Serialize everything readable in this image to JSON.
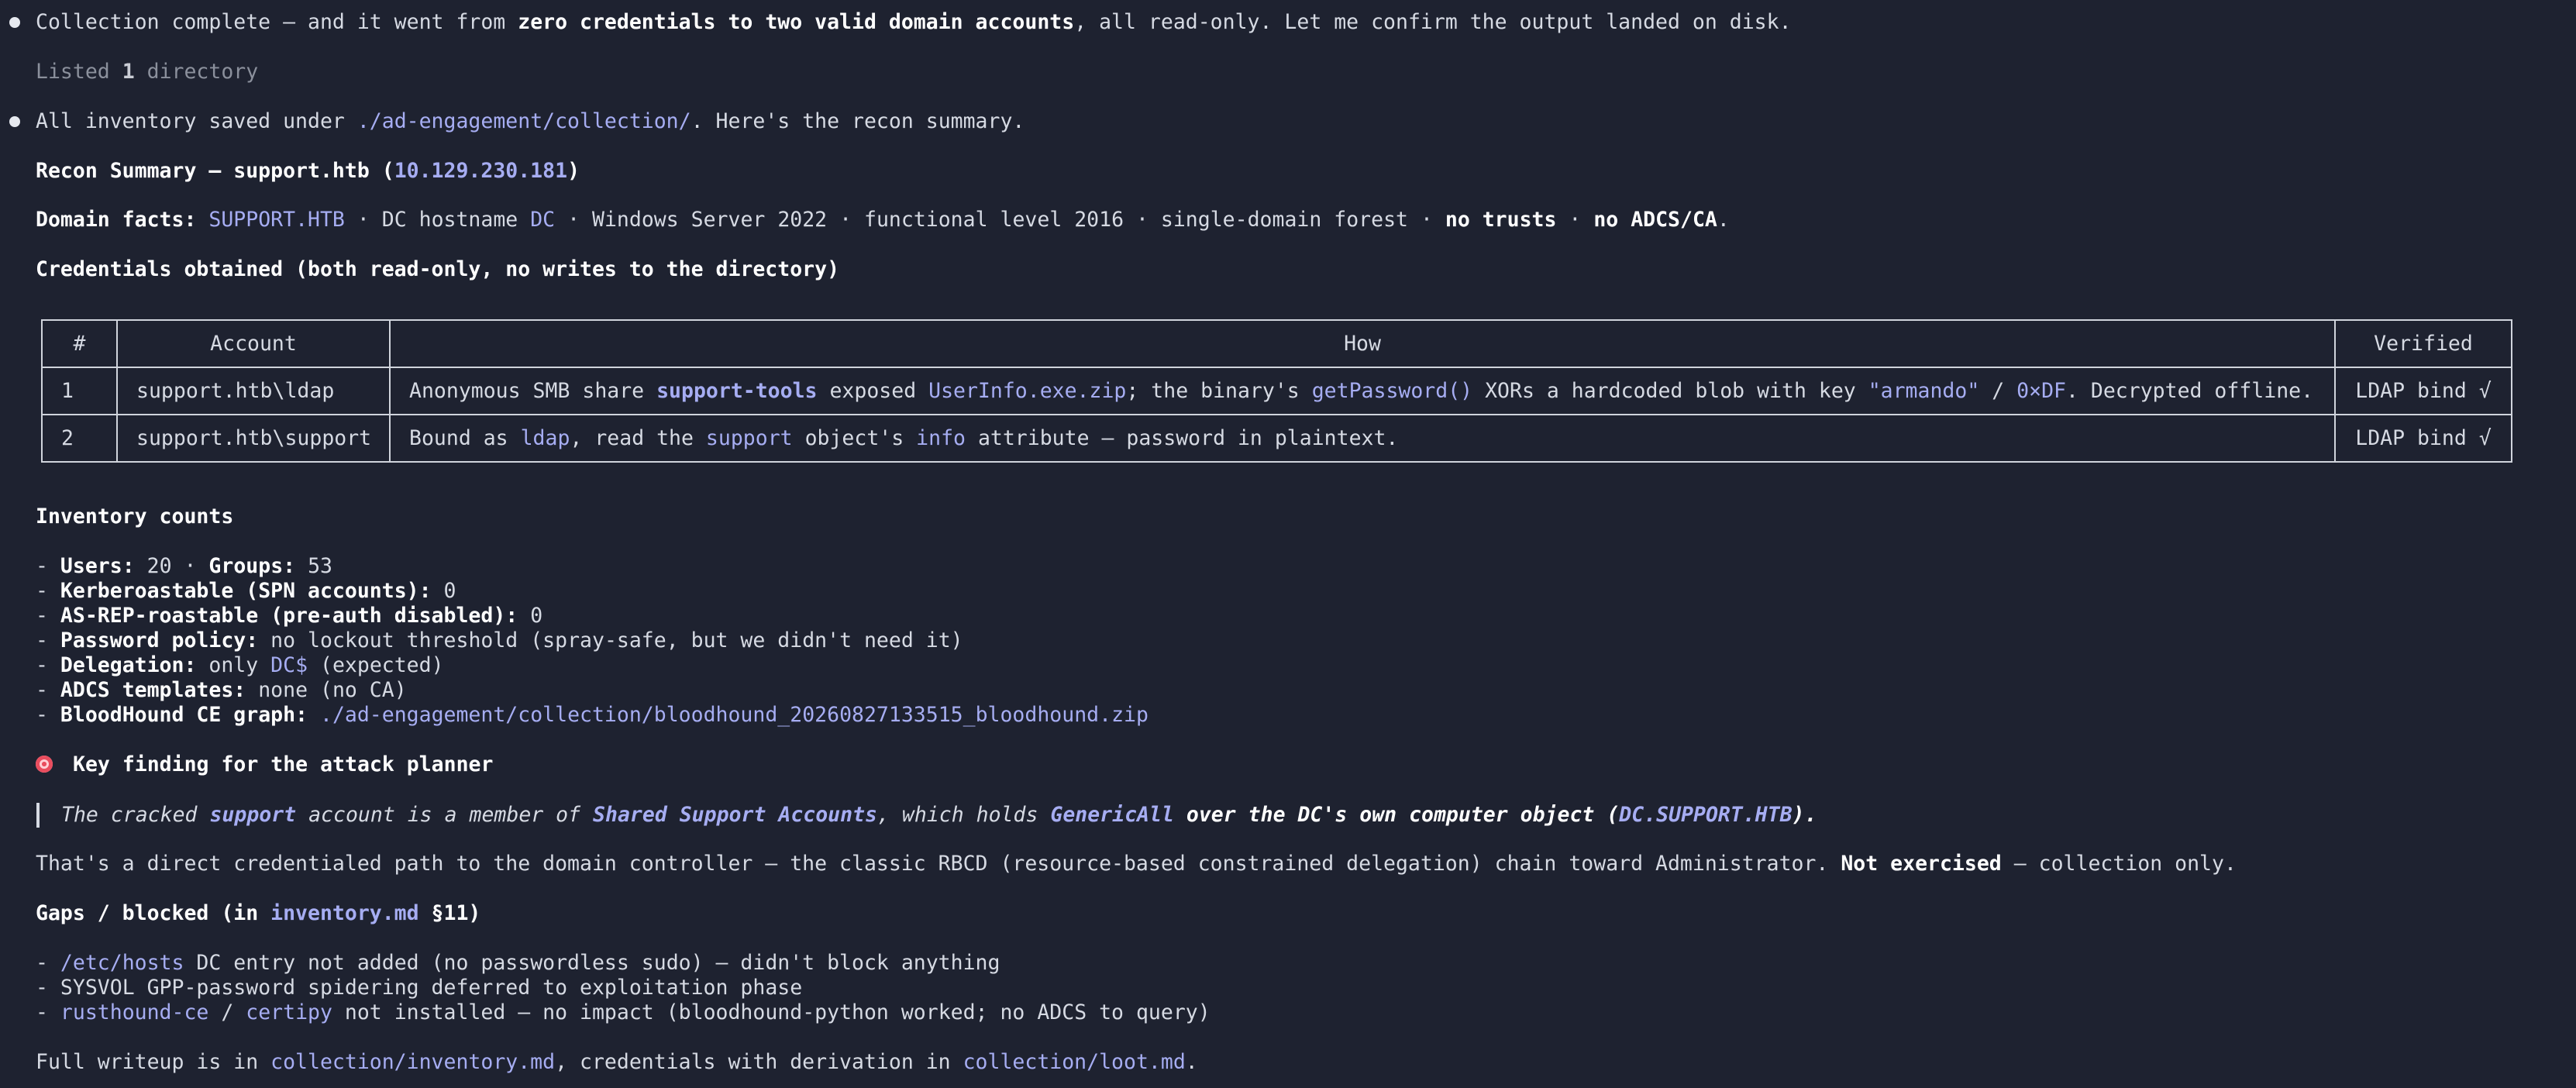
{
  "intro": {
    "pre": "Collection complete — and it went from ",
    "strong": "zero credentials to two valid domain accounts",
    "post": ", all read-only. Let me confirm the output landed on disk."
  },
  "tool_line": {
    "pre": "Listed ",
    "count": "1",
    "post": " directory"
  },
  "saved": {
    "pre": "All inventory saved under ",
    "path": "./ad-engagement/collection/",
    "post": ". Here's the recon summary."
  },
  "heading": {
    "pre": "Recon Summary — support.htb (",
    "ip": "10.129.230.181",
    "post": ")"
  },
  "facts": {
    "label": "Domain facts:",
    "domain": "SUPPORT.HTB",
    "s1": " · DC hostname ",
    "dc": "DC",
    "s2": " · Windows Server 2022 · functional level 2016 · single-domain forest · ",
    "trusts": "no trusts",
    "s3": " · ",
    "adcs": "no ADCS/CA",
    "s4": "."
  },
  "creds_heading": "Credentials obtained (both read-only, no writes to the directory)",
  "table": {
    "headers": [
      "#",
      "Account",
      "How",
      "Verified"
    ],
    "rows": [
      {
        "num": "1",
        "account": "support.htb\\ldap",
        "how": {
          "a": "Anonymous SMB share ",
          "share": "support-tools",
          "b": " exposed ",
          "file": "UserInfo.exe.zip",
          "c": "; the binary's ",
          "func": "getPassword()",
          "d": " XORs a hardcoded blob with key ",
          "key": "\"armando\"",
          "e": " / ",
          "hex": "0×DF",
          "f": ". Decrypted offline."
        },
        "verified": "LDAP bind √"
      },
      {
        "num": "2",
        "account": "support.htb\\support",
        "how": {
          "a": "Bound as ",
          "user": "ldap",
          "b": ", read the ",
          "obj": "support",
          "c": " object's ",
          "attr": "info",
          "d": " attribute — password in plaintext."
        },
        "verified": "LDAP bind √"
      }
    ]
  },
  "inventory": {
    "heading": "Inventory counts",
    "users_label": "Users:",
    "users": "20",
    "sep": " · ",
    "groups_label": "Groups:",
    "groups": "53",
    "kerb_label": "Kerberoastable (SPN accounts):",
    "kerb": "0",
    "asrep_label": "AS-REP-roastable (pre-auth disabled):",
    "asrep": "0",
    "pw_label": "Password policy:",
    "pw": "no lockout threshold (spray-safe, but we didn't need it)",
    "deleg_label": "Delegation:",
    "deleg_pre": "only ",
    "deleg_acct": "DC$",
    "deleg_post": " (expected)",
    "adcs_label": "ADCS templates:",
    "adcs": "none (no CA)",
    "bh_label": "BloodHound CE graph:",
    "bh": "./ad-engagement/collection/bloodhound_20260827133515_bloodhound.zip"
  },
  "finding": {
    "heading": "Key finding for the attack planner",
    "q1": "The cracked ",
    "q_support": "support",
    "q2": " account is a member of ",
    "q_group": "Shared Support Accounts",
    "q3": ", which holds ",
    "q_right": "GenericAll",
    "q4": "over the DC's own computer object (",
    "q_obj": "DC.SUPPORT.HTB",
    "q5": ")."
  },
  "path_line": {
    "pre": "That's a direct credentialed path to the domain controller — the classic RBCD (resource-based constrained delegation) chain toward Administrator. ",
    "strong": "Not exercised",
    "post": " — collection only."
  },
  "gaps": {
    "pre": "Gaps / blocked (in ",
    "file": "inventory.md",
    "post": " §11)",
    "g1_path": "/etc/hosts",
    "g1": " DC entry not added (no passwordless sudo) — didn't block anything",
    "g2": "SYSVOL GPP-password spidering deferred to exploitation phase",
    "g3_a": "rusthound-ce",
    "g3_sep": " / ",
    "g3_b": "certipy",
    "g3": " not installed — no impact (bloodhound-python worked; no ADCS to query)"
  },
  "footer": {
    "pre": "Full writeup is in ",
    "f1": "collection/inventory.md",
    "mid": ", credentials with derivation in ",
    "f2": "collection/loot.md",
    "post": "."
  }
}
